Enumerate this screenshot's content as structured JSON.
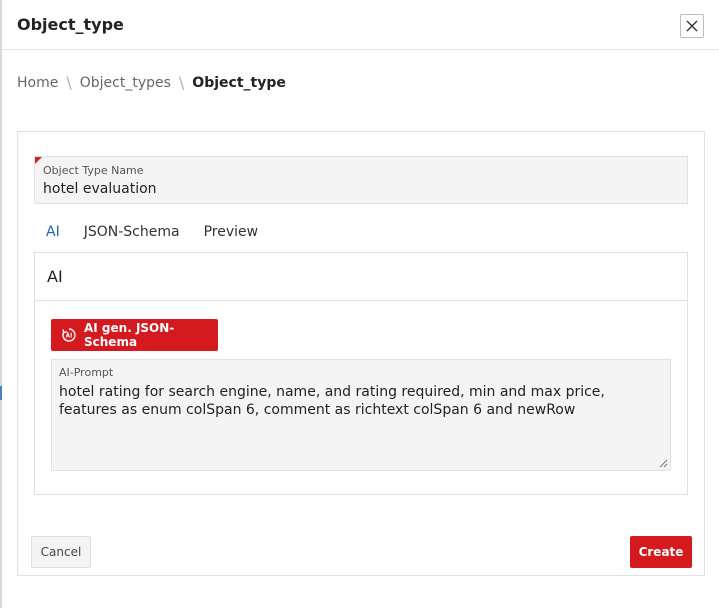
{
  "dialog": {
    "title": "Object_type"
  },
  "breadcrumb": [
    {
      "label": "Home"
    },
    {
      "label": "Object_types"
    },
    {
      "label": "Object_type"
    }
  ],
  "breadcrumb_separator": "\\",
  "form": {
    "name_field": {
      "label": "Object Type Name",
      "value": "hotel evaluation",
      "required": true
    },
    "tabs": [
      {
        "label": "AI",
        "active": true
      },
      {
        "label": "JSON-Schema",
        "active": false
      },
      {
        "label": "Preview",
        "active": false
      }
    ],
    "ai_panel": {
      "heading": "AI",
      "generate_button": "AI gen. JSON-Schema",
      "prompt": {
        "label": "AI-Prompt",
        "value": "hotel rating for search engine, name, and rating required, min  and  max price, features as enum colSpan 6, comment as richtext colSpan 6 and newRow"
      }
    }
  },
  "actions": {
    "cancel": "Cancel",
    "create": "Create"
  },
  "colors": {
    "accent_red": "#d4191f",
    "tab_active_blue": "#1e63b6"
  }
}
